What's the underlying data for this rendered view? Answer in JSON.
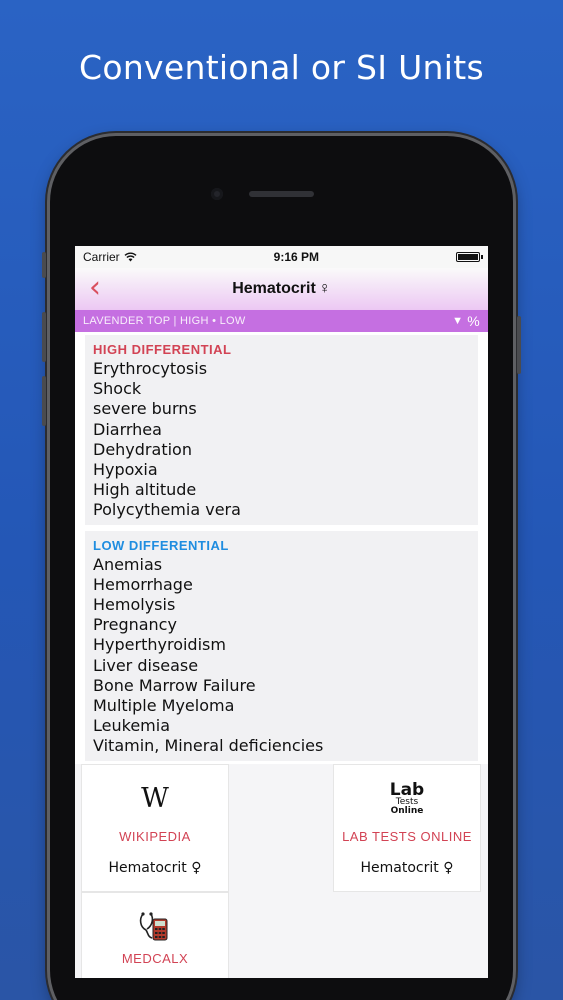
{
  "promo": {
    "headline": "Conventional or SI Units"
  },
  "status_bar": {
    "carrier": "Carrier",
    "time": "9:16 PM",
    "wifi_icon": "wifi-icon",
    "battery_icon": "battery-icon"
  },
  "nav": {
    "back_icon": "chevron-left-icon",
    "back_glyph": "‹",
    "title": "Hematocrit",
    "title_symbol": "♀"
  },
  "subbar": {
    "text": "LAVENDER TOP | HIGH • LOW",
    "filter_glyph": "▼",
    "unit_glyph": "%"
  },
  "high_differential": {
    "title": "HIGH DIFFERENTIAL",
    "color": "#d24354",
    "items": [
      "Erythrocytosis",
      "Shock",
      "severe burns",
      "Diarrhea",
      "Dehydration",
      "Hypoxia",
      "High altitude",
      "Polycythemia vera"
    ]
  },
  "low_differential": {
    "title": "LOW DIFFERENTIAL",
    "color": "#1f8de0",
    "items": [
      "Anemias",
      "Hemorrhage",
      "Hemolysis",
      "Pregnancy",
      "Hyperthyroidism",
      "Liver disease",
      "Bone Marrow Failure",
      "Multiple Myeloma",
      "Leukemia",
      "Vitamin, Mineral deficiencies"
    ]
  },
  "links": {
    "wikipedia": {
      "logo": "W",
      "name": "WIKIPEDIA",
      "subtitle": "Hematocrit ♀"
    },
    "labtests": {
      "logo_big": "Lab",
      "logo_small1": "Tests",
      "logo_small2": "Online",
      "name": "LAB TESTS ONLINE",
      "subtitle": "Hematocrit ♀"
    },
    "medcalx": {
      "logo_icon": "calculator-stethoscope-icon",
      "name": "MEDCALX"
    }
  }
}
